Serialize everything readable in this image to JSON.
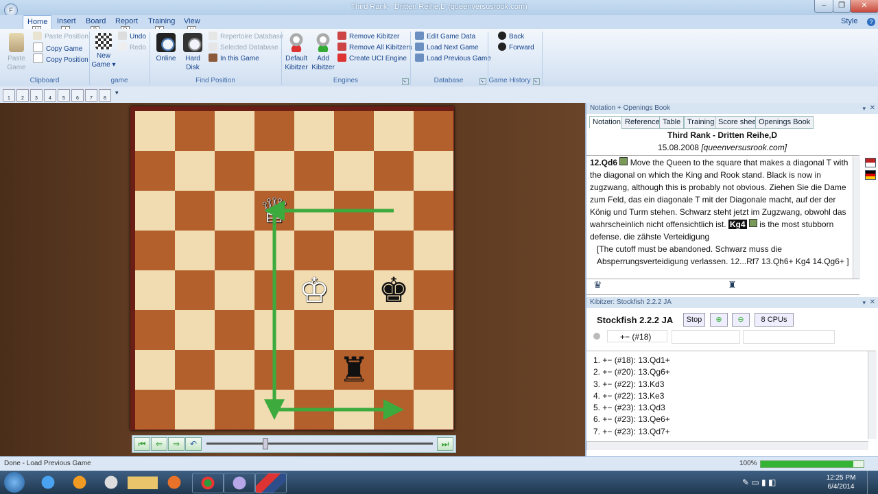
{
  "window": {
    "title": "Third Rank - Dritten Reihe,D  (queenversusrook.com)",
    "app_button": "F",
    "minimize": "–",
    "restore": "❐",
    "close": "✕"
  },
  "menu": {
    "tabs": [
      {
        "label": "Home",
        "keytip": "H"
      },
      {
        "label": "Insert",
        "keytip": "I"
      },
      {
        "label": "Board",
        "keytip": "B"
      },
      {
        "label": "Report",
        "keytip": "R"
      },
      {
        "label": "Training",
        "keytip": "T"
      },
      {
        "label": "View",
        "keytip": "V"
      }
    ],
    "style_label": "Style",
    "help": "?"
  },
  "ribbon": {
    "clipboard": {
      "paste": "Paste Game",
      "paste_position": "Paste Position",
      "copy_game": "Copy Game",
      "copy_position": "Copy Position",
      "label": "Clipboard"
    },
    "game": {
      "new_game": "New Game",
      "undo": "Undo",
      "redo": "Redo",
      "label": "game"
    },
    "find": {
      "online": "Online",
      "hard_disk": "Hard Disk",
      "repertoire_db": "Repertoire Database",
      "selected_db": "Selected Database",
      "in_this_game": "In this Game",
      "label": "Find Position"
    },
    "engines": {
      "default_kibitzer": "Default Kibitzer",
      "add_kibitzer": "Add Kibitzer",
      "remove_kibitzer": "Remove Kibitzer",
      "remove_all": "Remove All Kibitzers",
      "create_uci": "Create UCI Engine",
      "label": "Engines"
    },
    "database": {
      "edit_game": "Edit Game Data",
      "load_next": "Load Next Game",
      "load_prev": "Load Previous Game",
      "label": "Database"
    },
    "history": {
      "back": "Back",
      "forward": "Forward",
      "label": "Game History"
    }
  },
  "quick_toolbar": {
    "numbers": [
      "1",
      "2",
      "3",
      "4",
      "5",
      "6",
      "7",
      "8"
    ]
  },
  "board": {
    "pieces": [
      {
        "glyph": "♕",
        "square": "d6",
        "color": "white"
      },
      {
        "glyph": "♔",
        "square": "e4",
        "color": "white"
      },
      {
        "glyph": "♚",
        "square": "g4",
        "color": "black"
      },
      {
        "glyph": "♜",
        "square": "f2",
        "color": "black"
      }
    ],
    "arrows": [
      [
        "g6",
        "d6"
      ],
      [
        "d6",
        "d1"
      ],
      [
        "d1",
        "g1"
      ]
    ],
    "arrow_color": "#3caa3c"
  },
  "notation": {
    "pane_title": "Notation + Openings Book",
    "tabs": [
      "Notation",
      "Reference",
      "Table",
      "Training",
      "Score sheet",
      "Openings Book"
    ],
    "game_title": "Third Rank - Dritten Reihe,D",
    "date_line": "15.08.2008",
    "source": "[queenversusrook.com]",
    "move1": "12.Qd6",
    "comment1": " Move the Queen to the square that makes a diagonal T with the diagonal on which the King and Rook stand.  Black is now in zugzwang, although this is probably not obvious. Ziehen Sie die Dame zum Feld, das ein diagonale T mit der Diagonale macht, auf der der König und Turm stehen. Schwarz steht jetzt im Zugzwang, obwohl das wahrscheinlich nicht offensichtlich ist. ",
    "move2": "Kg4",
    "comment2": " is the most stubborn defense. die zähste Verteidigung",
    "variation": "[The cutoff must be abandoned. Schwarz muss die Absperrungsverteidigung verlassen.  12...Rf7  13.Qh6+  Kg4  14.Qg6+ ]"
  },
  "kibitzer": {
    "pane_title": "Kibitzer: Stockfish 2.2.2 JA",
    "engine": "Stockfish 2.2.2 JA",
    "stop": "Stop",
    "cpus": "8 CPUs",
    "eval": "+−  (#18)",
    "lines": [
      "1. +−  (#18): 13.Qd1+",
      "2. +−  (#20): 13.Qg6+",
      "3. +−  (#22): 13.Kd3",
      "4. +−  (#22): 13.Ke3",
      "5. +−  (#23): 13.Qd3",
      "6. +−  (#23): 13.Qe6+",
      "7. +−  (#23): 13.Qd7+"
    ]
  },
  "status": {
    "text": "Done - Load Previous Game",
    "zoom": "100%",
    "progress": 0.9
  },
  "taskbar": {
    "time": "12:25 PM",
    "date": "6/4/2014"
  }
}
